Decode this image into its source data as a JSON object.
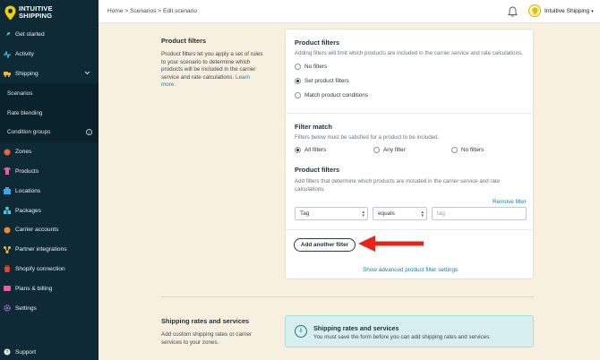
{
  "brand": {
    "line1": "INTUITIVE",
    "line2": "SHIPPING"
  },
  "sidebar": {
    "items": [
      {
        "label": "Get started",
        "icon": "rocket-icon",
        "color": "#4cd0a0"
      },
      {
        "label": "Activity",
        "icon": "activity-icon",
        "color": "#49b7e8"
      },
      {
        "label": "Shipping",
        "icon": "truck-icon",
        "color": "#f2b233"
      }
    ],
    "sub_items": [
      {
        "label": "Scenarios"
      },
      {
        "label": "Rate blending"
      },
      {
        "label": "Condition groups"
      }
    ],
    "items2": [
      {
        "label": "Zones",
        "icon": "globe-icon",
        "color": "#f0643c"
      },
      {
        "label": "Products",
        "icon": "shirt-icon",
        "color": "#ef5b9d"
      },
      {
        "label": "Locations",
        "icon": "building-icon",
        "color": "#3fa5e8"
      },
      {
        "label": "Packages",
        "icon": "boxes-icon",
        "color": "#4cc3e6"
      },
      {
        "label": "Carrier accounts",
        "icon": "carrier-icon",
        "color": "#f08a2c"
      },
      {
        "label": "Partner integrations",
        "icon": "integrations-icon",
        "color": "#f2c13a"
      },
      {
        "label": "Shopify connection",
        "icon": "shopify-icon",
        "color": "#e6462f"
      },
      {
        "label": "Plans & billing",
        "icon": "billing-icon",
        "color": "#ef5b9d"
      },
      {
        "label": "Settings",
        "icon": "gear-icon",
        "color": "#b06ee8"
      }
    ],
    "support": "Support"
  },
  "topbar": {
    "breadcrumb": "Home > Scenarios > Edit scenario",
    "account": "Intuitive Shipping"
  },
  "left": {
    "product_filters_title": "Product filters",
    "product_filters_desc": "Product filters let you apply a set of rules to your scenario to determine which products will be included in the carrier service and rate calculations.",
    "learn_more": "Learn more.",
    "shipping_title": "Shipping rates and services",
    "shipping_desc": "Add custom shipping rates or carrier services to your zones."
  },
  "card": {
    "pf_title": "Product filters",
    "pf_desc": "Adding filters will limit which products are included in the carrier service and rate calculations.",
    "options": [
      "No filters",
      "Set product filters",
      "Match product conditions"
    ],
    "fm_title": "Filter match",
    "fm_desc": "Filters below must be satisfied for a product to be included.",
    "match_options": [
      "All filters",
      "Any filter",
      "No filters"
    ],
    "pf2_title": "Product filters",
    "pf2_desc": "Add filters that determine which products are included in the carrier service and rate calculations.",
    "remove_filter": "Remove filter",
    "field_select": "Tag",
    "operator_select": "equals",
    "value_placeholder": "tag",
    "add_filter": "Add another filter",
    "advanced": "Show advanced product filter settings"
  },
  "notice": {
    "title": "Shipping rates and services",
    "text": "You must save the form before you can add shipping rates and services."
  }
}
